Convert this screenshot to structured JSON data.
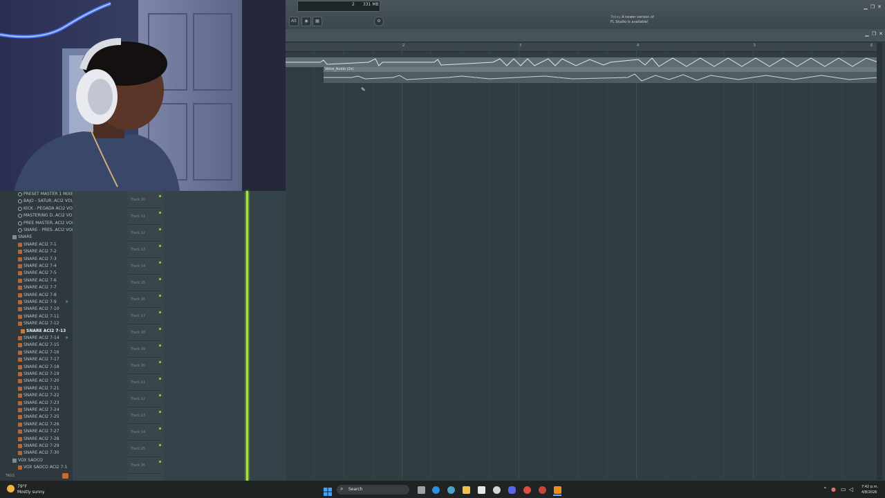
{
  "toolbar": {
    "pattern_num": "2",
    "memory": "331 MB",
    "news_day": "Today",
    "news_text": "A newer version of FL Studio is available!",
    "alt_btn": "Alt",
    "icons": [
      "record-icon",
      "pattern-icon",
      "update-icon"
    ]
  },
  "playlist": {
    "ruler_numbers": [
      "2",
      "3",
      "4",
      "5",
      "6",
      "7"
    ],
    "clip_label": "Voice_Audio (2x)"
  },
  "browser": {
    "items": [
      {
        "label": "PRESET MASTER 1 MIXER",
        "type": "preset"
      },
      {
        "label": "BAJO - SATUR..ACI2 VOL 7",
        "type": "preset"
      },
      {
        "label": "KICK - PEGADA ACI2 VOL 7",
        "type": "preset"
      },
      {
        "label": "MASTERING D..ACI2 VOL 7",
        "type": "preset"
      },
      {
        "label": "PREE MASTER..ACI2 VOL 7",
        "type": "preset"
      },
      {
        "label": "SNARE - PRES..ACI2 VOL 7",
        "type": "preset"
      },
      {
        "label": "SNARE",
        "type": "folder"
      },
      {
        "label": "SNARE ACI2 7-1",
        "type": "sample"
      },
      {
        "label": "SNARE ACI2 7-2",
        "type": "sample"
      },
      {
        "label": "SNARE ACI2 7-3",
        "type": "sample"
      },
      {
        "label": "SNARE ACI2 7-4",
        "type": "sample"
      },
      {
        "label": "SNARE ACI2 7-5",
        "type": "sample"
      },
      {
        "label": "SNARE ACI2 7-6",
        "type": "sample"
      },
      {
        "label": "SNARE ACI2 7-7",
        "type": "sample"
      },
      {
        "label": "SNARE ACI2 7-8",
        "type": "sample"
      },
      {
        "label": "SNARE ACI2 7-9",
        "type": "sample",
        "star": true
      },
      {
        "label": "SNARE ACI2 7-10",
        "type": "sample"
      },
      {
        "label": "SNARE ACI2 7-11",
        "type": "sample"
      },
      {
        "label": "SNARE ACI2 7-12",
        "type": "sample"
      },
      {
        "label": "SNARE ACI2 7-13",
        "type": "sample",
        "selected": true
      },
      {
        "label": "SNARE ACI2 7-14",
        "type": "sample",
        "star": true
      },
      {
        "label": "SNARE ACI2 7-15",
        "type": "sample"
      },
      {
        "label": "SNARE ACI2 7-16",
        "type": "sample"
      },
      {
        "label": "SNARE ACI2 7-17",
        "type": "sample"
      },
      {
        "label": "SNARE ACI2 7-18",
        "type": "sample"
      },
      {
        "label": "SNARE ACI2 7-19",
        "type": "sample"
      },
      {
        "label": "SNARE ACI2 7-20",
        "type": "sample"
      },
      {
        "label": "SNARE ACI2 7-21",
        "type": "sample"
      },
      {
        "label": "SNARE ACI2 7-22",
        "type": "sample"
      },
      {
        "label": "SNARE ACI2 7-23",
        "type": "sample"
      },
      {
        "label": "SNARE ACI2 7-24",
        "type": "sample"
      },
      {
        "label": "SNARE ACI2 7-25",
        "type": "sample"
      },
      {
        "label": "SNARE ACI2 7-26",
        "type": "sample"
      },
      {
        "label": "SNARE ACI2 7-27",
        "type": "sample"
      },
      {
        "label": "SNARE ACI2 7-28",
        "type": "sample"
      },
      {
        "label": "SNARE ACI2 7-29",
        "type": "sample"
      },
      {
        "label": "SNARE ACI2 7-30",
        "type": "sample"
      },
      {
        "label": "VOX SAOCO",
        "type": "folder"
      },
      {
        "label": "VOX SAOCO ACI2 7-1",
        "type": "sample"
      }
    ],
    "tags_label": "TAGS"
  },
  "tracks": [
    "Track 10",
    "Track 11",
    "Track 12",
    "Track 13",
    "Track 14",
    "Track 15",
    "Track 16",
    "Track 17",
    "Track 18",
    "Track 19",
    "Track 20",
    "Track 21",
    "Track 22",
    "Track 23",
    "Track 24",
    "Track 25",
    "Track 26"
  ],
  "taskbar": {
    "weather_temp": "79°F",
    "weather_desc": "Mostly sunny",
    "search_label": "Search",
    "time": "7:42 p.m.",
    "date": "4/8/2026"
  },
  "colors": {
    "playhead": "#a5e04a",
    "playlist_bg": "#313d41",
    "taskbar": "#202324",
    "win_accent": "#2b8cf0"
  }
}
